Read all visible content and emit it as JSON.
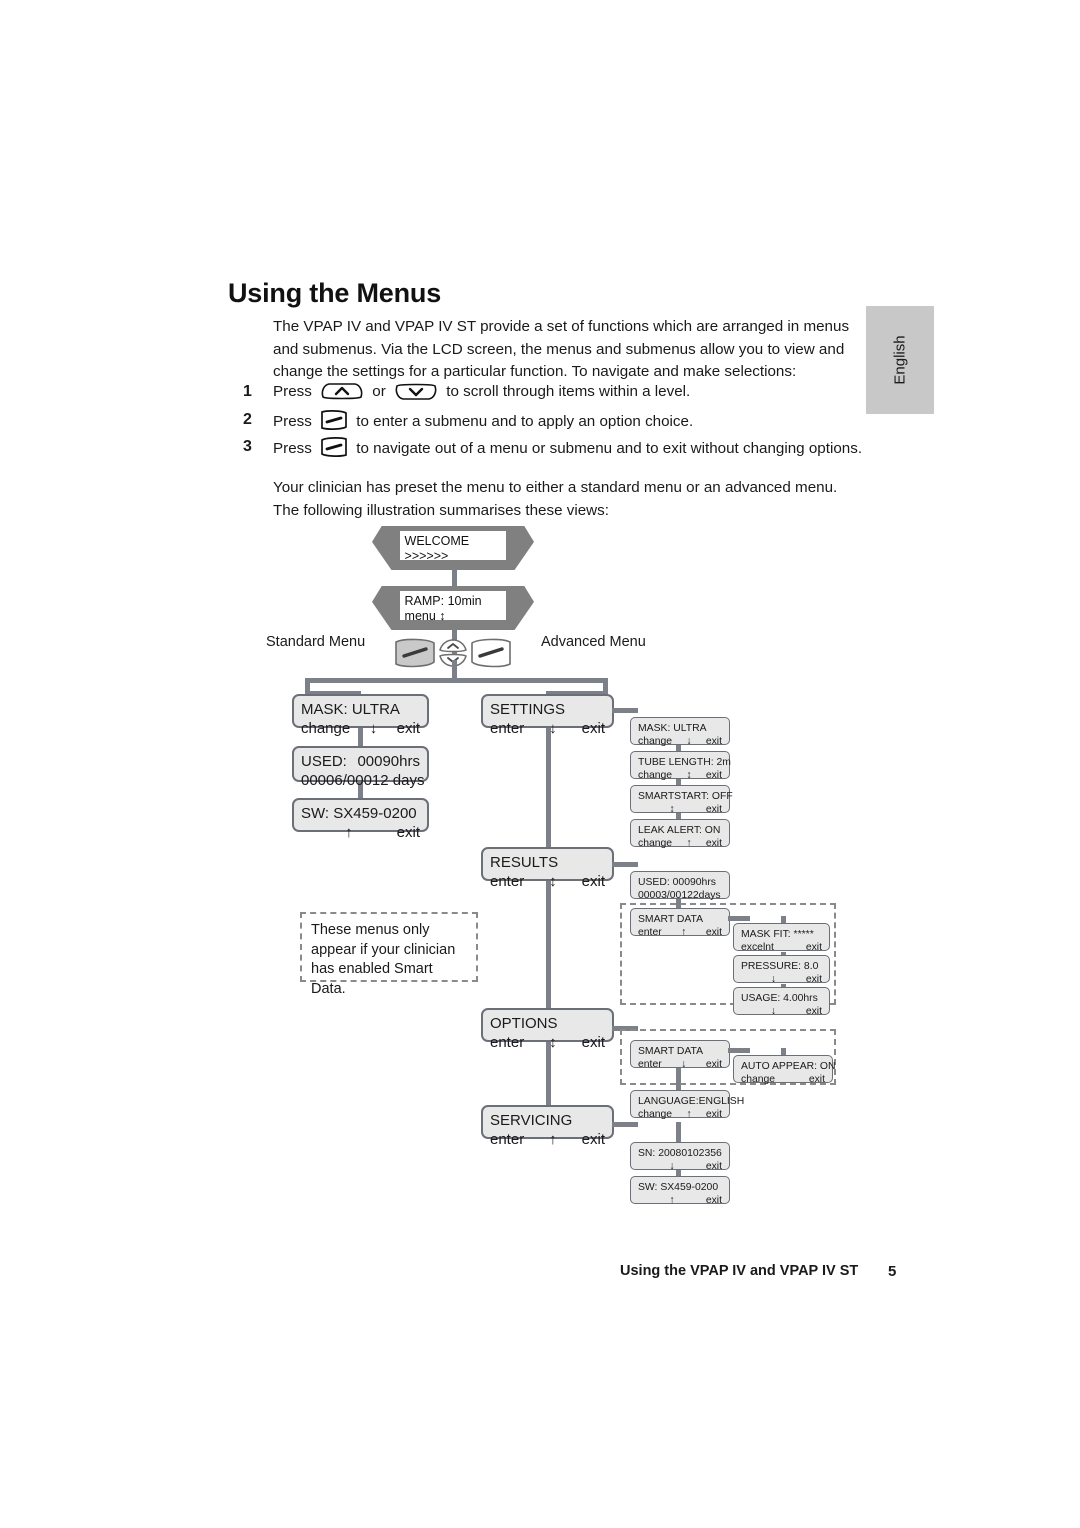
{
  "page": {
    "title": "Using the Menus",
    "intro": "The VPAP IV and VPAP IV ST provide a set of functions which are arranged in menus and submenus. Via the LCD screen, the menus and submenus allow you to view and change the settings for a particular function. To navigate and make selections:",
    "closing": "Your clinician has preset the menu to either a standard menu or an advanced menu. The following illustration summarises these views:",
    "side_tab": "English",
    "footer_text": "Using the VPAP IV and VPAP IV ST",
    "page_number": "5"
  },
  "steps": [
    {
      "num": "1",
      "before": "Press",
      "mid": "or",
      "after": "to scroll through items within a level."
    },
    {
      "num": "2",
      "before": "Press",
      "after": "to enter a submenu and to apply an option choice."
    },
    {
      "num": "3",
      "before": "Press",
      "after": "to navigate out of a menu or submenu and to exit without changing options."
    }
  ],
  "diagram": {
    "labels": {
      "standard": "Standard Menu",
      "advanced": "Advanced Menu"
    },
    "note": "These menus only appear if your clinician has enabled Smart Data.",
    "devices": [
      {
        "line1": "WELCOME",
        "line2": ">>>>>>"
      },
      {
        "line1": "RAMP: 10min",
        "line2": "menu      ↕"
      }
    ],
    "standard_menu": [
      {
        "title": "MASK:  ULTRA",
        "left": "change",
        "mid": "↓",
        "right": "exit"
      },
      {
        "title": "USED:",
        "title_right": "00090hrs",
        "left": "00006/00012 days",
        "mid": "",
        "right": ""
      },
      {
        "title": "SW: SX459-0200",
        "left": "",
        "mid": "↑",
        "right": "exit"
      }
    ],
    "advanced_menu": [
      {
        "title": "SETTINGS",
        "left": "enter",
        "mid": "↓",
        "right": "exit",
        "children": [
          {
            "title": "MASK:  ULTRA",
            "left": "change",
            "mid": "↓",
            "right": "exit"
          },
          {
            "title": "TUBE LENGTH: 2m",
            "left": "change",
            "mid": "↕",
            "right": "exit"
          },
          {
            "title": "SMARTSTART: OFF",
            "left": "",
            "mid": "↕",
            "right": "exit"
          },
          {
            "title": "LEAK ALERT: ON",
            "left": "change",
            "mid": "↑",
            "right": "exit"
          }
        ]
      },
      {
        "title": "RESULTS",
        "left": "enter",
        "mid": "↕",
        "right": "exit",
        "children": [
          {
            "title": "USED: 00090hrs",
            "left": "00003/00122days",
            "mid": "",
            "right": ""
          },
          {
            "title": "SMART DATA",
            "left": "enter",
            "mid": "↑",
            "right": "exit"
          }
        ],
        "grandchildren": [
          {
            "title": "MASK FIT: *****",
            "left": "excelnt",
            "mid": "",
            "right": "exit"
          },
          {
            "title": "PRESSURE: 8.0",
            "left": "",
            "mid": "↓",
            "right": "exit"
          },
          {
            "title": "USAGE:   4.00hrs",
            "left": "",
            "mid": "↓",
            "right": "exit"
          }
        ]
      },
      {
        "title": "OPTIONS",
        "left": "enter",
        "mid": "↕",
        "right": "exit",
        "children": [
          {
            "title": "SMART DATA",
            "left": "enter",
            "mid": "↓",
            "right": "exit"
          },
          {
            "title": "LANGUAGE:ENGLISH",
            "left": "change",
            "mid": "↑",
            "right": "exit"
          }
        ],
        "grandchildren": [
          {
            "title": "AUTO APPEAR: ON",
            "left": "change",
            "mid": "",
            "right": "exit"
          }
        ]
      },
      {
        "title": "SERVICING",
        "left": "enter",
        "mid": "↑",
        "right": "exit",
        "children": [
          {
            "title": "SN: 20080102356",
            "left": "",
            "mid": "↓",
            "right": "exit"
          },
          {
            "title": "SW: SX459-0200",
            "left": "",
            "mid": "↑",
            "right": "exit"
          }
        ]
      }
    ]
  },
  "colors": {
    "device_shell": "#808080",
    "box_fill": "#e8e8e8",
    "box_border": "#6b6f78",
    "connector": "#7c8088",
    "side_tab": "#c8c8c8"
  }
}
